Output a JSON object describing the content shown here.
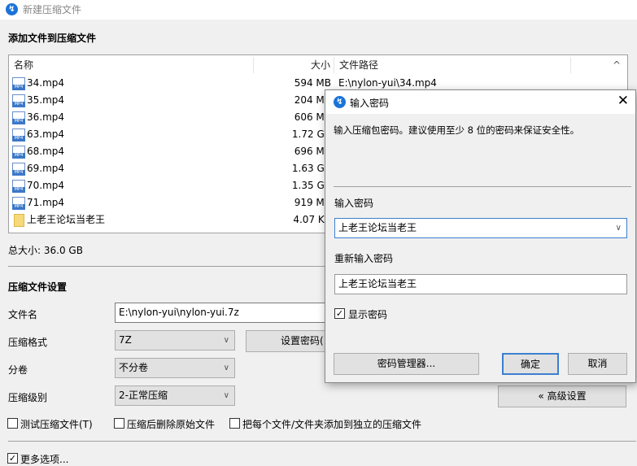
{
  "window": {
    "title": "新建压缩文件"
  },
  "section_add": "添加文件到压缩文件",
  "list": {
    "headers": {
      "name": "名称",
      "size": "大小",
      "path": "文件路径"
    },
    "rows": [
      {
        "name": "34.mp4",
        "size": "594 MB",
        "path": "E:\\nylon-yui\\34.mp4",
        "type": "mp4"
      },
      {
        "name": "35.mp4",
        "size": "204 MB",
        "path": "",
        "type": "mp4"
      },
      {
        "name": "36.mp4",
        "size": "606 MB",
        "path": "",
        "type": "mp4"
      },
      {
        "name": "63.mp4",
        "size": "1.72 GB",
        "path": "",
        "type": "mp4"
      },
      {
        "name": "68.mp4",
        "size": "696 MB",
        "path": "",
        "type": "mp4"
      },
      {
        "name": "69.mp4",
        "size": "1.63 GB",
        "path": "",
        "type": "mp4"
      },
      {
        "name": "70.mp4",
        "size": "1.35 GB",
        "path": "",
        "type": "mp4"
      },
      {
        "name": "71.mp4",
        "size": "919 MB",
        "path": "",
        "type": "mp4"
      },
      {
        "name": "上老王论坛当老王",
        "size": "4.07 KB",
        "path": "",
        "type": "folder"
      }
    ]
  },
  "total_size": "总大小: 36.0 GB",
  "settings": {
    "title": "压缩文件设置",
    "filename_label": "文件名",
    "filename_value": "E:\\nylon-yui\\nylon-yui.7z",
    "format_label": "压缩格式",
    "format_value": "7Z",
    "set_password": "设置密码(",
    "split_label": "分卷",
    "split_value": "不分卷",
    "level_label": "压缩级别",
    "level_value": "2-正常压缩",
    "advanced": "« 高级设置",
    "test": "测试压缩文件(T)",
    "delete_after": "压缩后删除原始文件",
    "separate": "把每个文件/文件夹添加到独立的压缩文件",
    "more_options": "更多选项..."
  },
  "dialog": {
    "title": "输入密码",
    "description": "输入压缩包密码。建议使用至少 8 位的密码来保证安全性。",
    "password_label": "输入密码",
    "password_value": "上老王论坛当老王",
    "reenter_label": "重新输入密码",
    "reenter_value": "上老王论坛当老王",
    "show_password": "显示密码",
    "manager": "密码管理器...",
    "ok": "确定",
    "cancel": "取消"
  }
}
